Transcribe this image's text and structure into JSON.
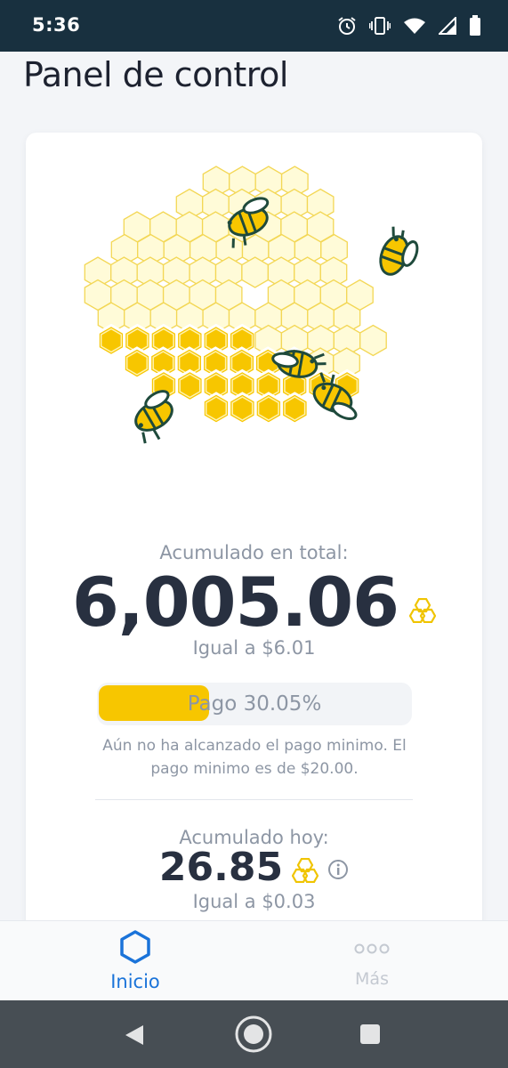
{
  "status_bar": {
    "time": "5:36",
    "icons": [
      "alarm-icon",
      "vibrate-icon",
      "wifi-icon",
      "signal-icon",
      "battery-icon"
    ]
  },
  "header": {
    "title": "Panel de control"
  },
  "earnings": {
    "total_label": "Acumulado en total:",
    "total_value": "6,005.06",
    "total_equal": "Igual a $6.01",
    "payout_progress_label": "Pago 30.05%",
    "payout_progress_percent": 30.05,
    "payout_note": "Aún no ha alcanzado el pago minimo. El pago minimo es de $20.00.",
    "today_label": "Acumulado hoy:",
    "today_value": "26.85",
    "today_equal": "Igual a $0.03"
  },
  "bottom_nav": {
    "items": [
      {
        "label": "Inicio",
        "icon": "hexagon-icon",
        "active": true
      },
      {
        "label": "Más",
        "icon": "more-dots-icon",
        "active": false
      }
    ]
  },
  "system_nav": [
    "back-icon",
    "home-icon",
    "recents-icon"
  ],
  "colors": {
    "status_bar": "#18303f",
    "honey": "#f7c600",
    "honey_light": "#fffbd8",
    "accent_blue": "#1a73d9",
    "text_dark": "#283040",
    "text_muted": "#8d96a4"
  }
}
